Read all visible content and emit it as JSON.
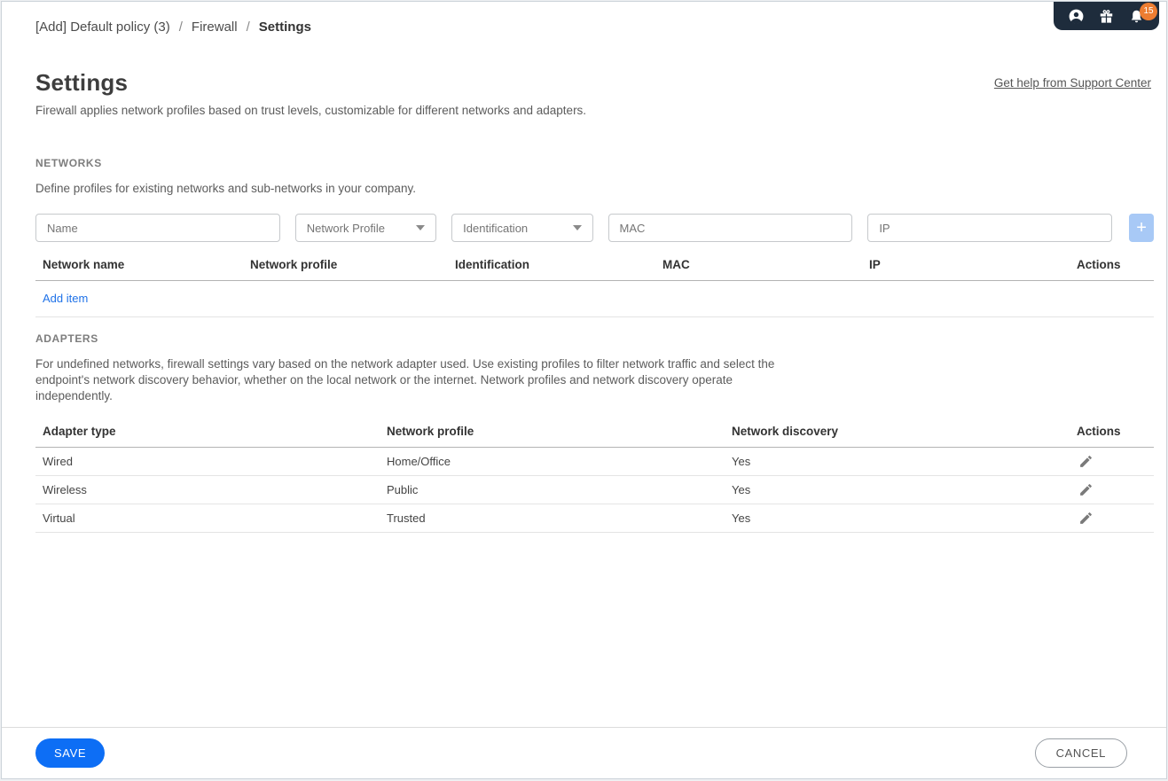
{
  "topbar": {
    "breadcrumb": {
      "0": "[Add] Default policy (3)",
      "1": "Firewall",
      "2": "Settings",
      "separator": "/"
    },
    "icons": {
      "0": "user-icon",
      "1": "gift-icon",
      "2": "bell-icon"
    },
    "notification_count": "15"
  },
  "header": {
    "title": "Settings",
    "description": "Firewall applies network profiles based on trust levels, customizable for different networks and adapters.",
    "help_link": "Get help from Support Center"
  },
  "networks": {
    "section_label": "NETWORKS",
    "description": "Define profiles for existing networks and sub-networks in your company.",
    "filters": {
      "name_placeholder": "Name",
      "profile_placeholder": "Network Profile",
      "identification_placeholder": "Identification",
      "mac_placeholder": "MAC",
      "ip_placeholder": "IP",
      "add_button_label": "+"
    },
    "columns": {
      "0": "Network name",
      "1": "Network profile",
      "2": "Identification",
      "3": "MAC",
      "4": "IP",
      "5": "Actions"
    },
    "add_item_label": "Add item"
  },
  "adapters": {
    "section_label": "ADAPTERS",
    "description": "For undefined networks, firewall settings vary based on the network adapter used. Use existing profiles to filter network traffic and select the endpoint's network discovery behavior, whether on the local network or the internet. Network profiles and network discovery operate independently.",
    "columns": {
      "0": "Adapter type",
      "1": "Network profile",
      "2": "Network discovery",
      "3": "Actions"
    },
    "rows": {
      "0": {
        "adapter_type": "Wired",
        "network_profile": "Home/Office",
        "network_discovery": "Yes"
      },
      "1": {
        "adapter_type": "Wireless",
        "network_profile": "Public",
        "network_discovery": "Yes"
      },
      "2": {
        "adapter_type": "Virtual",
        "network_profile": "Trusted",
        "network_discovery": "Yes"
      }
    }
  },
  "footer": {
    "save_label": "SAVE",
    "cancel_label": "CANCEL"
  },
  "colors": {
    "primary_blue": "#0d6ef5",
    "add_button_disabled_blue": "#a8c9f6",
    "link_blue": "#1f72e8",
    "topbar_navy": "#1e2c3c",
    "notification_orange": "#ed7d31"
  }
}
